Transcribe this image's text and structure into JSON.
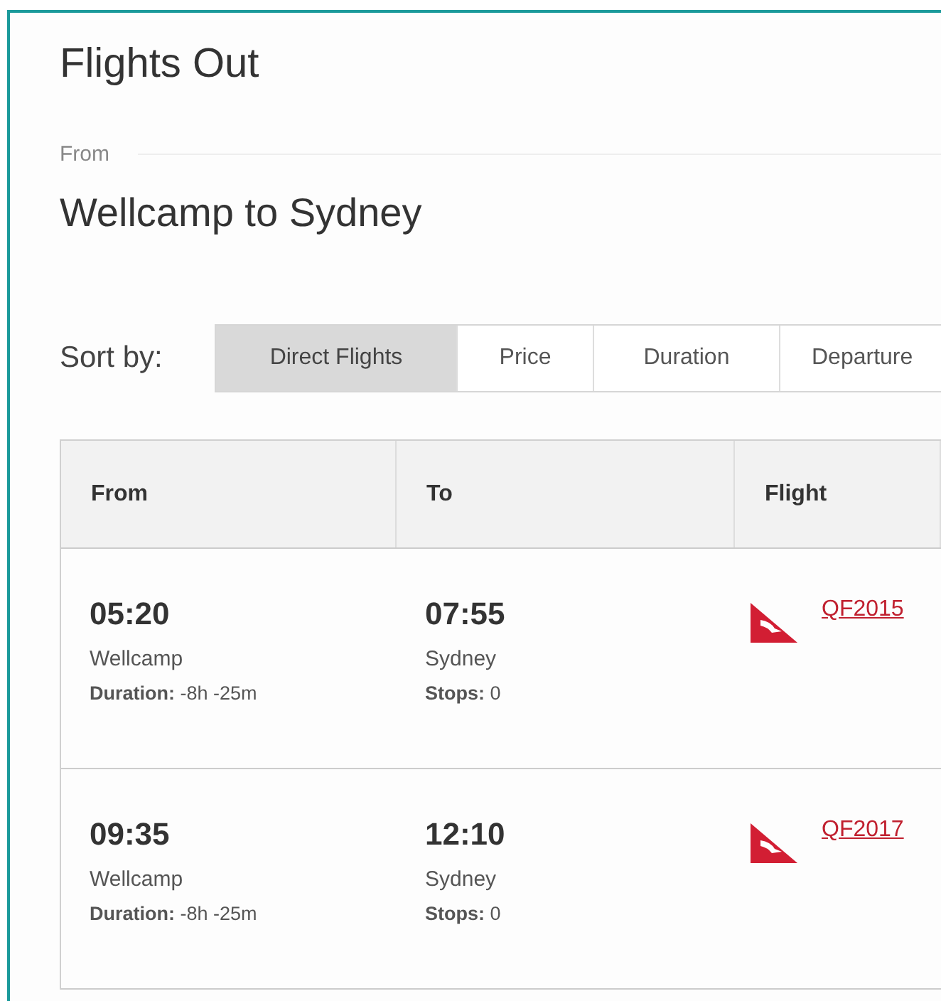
{
  "page": {
    "title": "Flights Out",
    "from_label": "From",
    "route": "Wellcamp to Sydney"
  },
  "sort": {
    "label": "Sort by:",
    "options": [
      {
        "label": "Direct Flights",
        "selected": true
      },
      {
        "label": "Price",
        "selected": false
      },
      {
        "label": "Duration",
        "selected": false
      },
      {
        "label": "Departure",
        "selected": false
      }
    ]
  },
  "table": {
    "columns": [
      "From",
      "To",
      "Flight"
    ],
    "rows": [
      {
        "depart_time": "05:20",
        "origin": "Wellcamp",
        "duration": "**Duration:** -8h -25m",
        "arrive_time": "07:55",
        "destination": "Sydney",
        "stops": "**Stops:** 0",
        "flight": "QF2015"
      },
      {
        "depart_time": "09:35",
        "origin": "Wellcamp",
        "duration": "**Duration:** -8h -25m",
        "arrive_time": "12:10",
        "destination": "Sydney",
        "stops": "**Stops:** 0",
        "flight": "QF2017"
      }
    ]
  }
}
